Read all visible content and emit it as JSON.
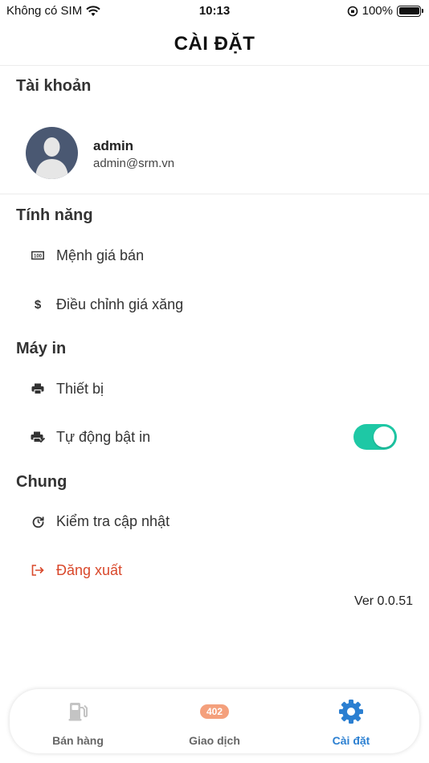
{
  "status_bar": {
    "carrier": "Không có SIM",
    "time": "10:13",
    "battery": "100%"
  },
  "header": {
    "title": "CÀI ĐẶT"
  },
  "account": {
    "section_title": "Tài khoản",
    "username": "admin",
    "email": "admin@srm.vn"
  },
  "features": {
    "section_title": "Tính năng",
    "items": [
      {
        "label": "Mệnh giá bán",
        "icon": "denomination-icon"
      },
      {
        "label": "Điều chỉnh giá xăng",
        "icon": "dollar-icon"
      }
    ]
  },
  "printer": {
    "section_title": "Máy in",
    "items": [
      {
        "label": "Thiết bị",
        "icon": "printer-icon"
      },
      {
        "label": "Tự động bật in",
        "icon": "printer-auto-icon",
        "toggle_on": true
      }
    ]
  },
  "general": {
    "section_title": "Chung",
    "items": [
      {
        "label": "Kiểm tra cập nhật",
        "icon": "update-icon"
      },
      {
        "label": "Đăng xuất",
        "icon": "logout-icon"
      }
    ]
  },
  "version": "Ver 0.0.51",
  "tabbar": {
    "tabs": [
      {
        "label": "Bán hàng",
        "icon": "fuel-pump-icon",
        "active": false
      },
      {
        "label": "Giao dịch",
        "icon": "transactions-icon",
        "badge": "402",
        "active": false
      },
      {
        "label": "Cài đặt",
        "icon": "gear-icon",
        "active": true
      }
    ]
  },
  "colors": {
    "accent": "#2b7fd1",
    "toggle_on": "#1ec8a5",
    "logout": "#d9482b",
    "badge": "#f4a07c"
  }
}
